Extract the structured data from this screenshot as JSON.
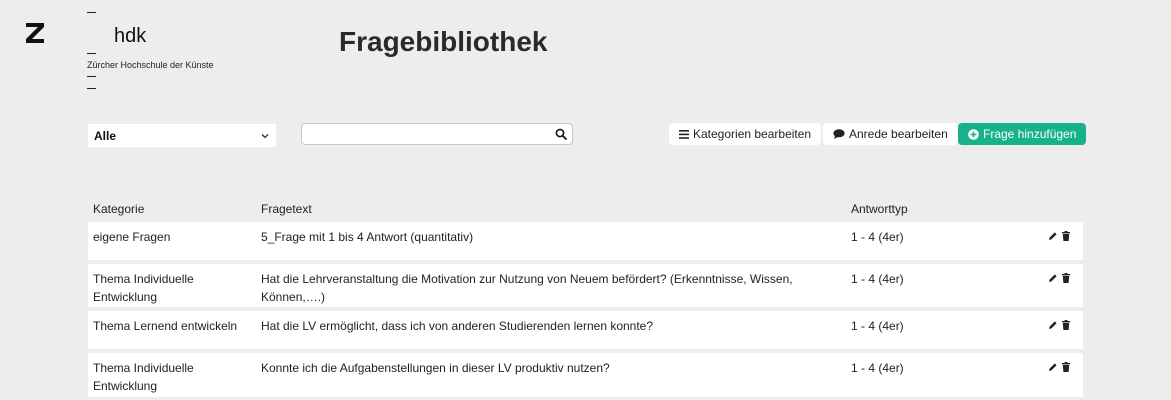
{
  "brand": {
    "name": "hdk",
    "subtitle": "Zürcher Hochschule der Künste"
  },
  "page_title": "Fragebibliothek",
  "filter": {
    "selected": "Alle"
  },
  "search": {
    "value": "",
    "placeholder": ""
  },
  "buttons": {
    "categories": "Kategorien bearbeiten",
    "salutation": "Anrede bearbeiten",
    "add_question": "Frage hinzufügen"
  },
  "colors": {
    "accent": "#17b28c",
    "background": "#ededed"
  },
  "table": {
    "headers": {
      "category": "Kategorie",
      "question": "Fragetext",
      "answer_type": "Antworttyp"
    },
    "rows": [
      {
        "category": "eigene Fragen",
        "question": "5_Frage mit 1 bis 4 Antwort (quantitativ)",
        "answer_type": "1 - 4 (4er)"
      },
      {
        "category": "Thema Individuelle Entwicklung",
        "question": "Hat die Lehrveranstaltung die Motivation zur Nutzung von Neuem befördert? (Erkenntnisse, Wissen, Können,….)",
        "answer_type": "1 - 4 (4er)"
      },
      {
        "category": "Thema Lernend entwickeln",
        "question": "Hat die LV ermöglicht, dass ich von anderen Studierenden lernen konnte?",
        "answer_type": "1 - 4 (4er)"
      },
      {
        "category": "Thema Individuelle Entwicklung",
        "question": "Konnte ich die Aufgabenstellungen in dieser LV produktiv nutzen?",
        "answer_type": "1 - 4 (4er)"
      }
    ]
  }
}
